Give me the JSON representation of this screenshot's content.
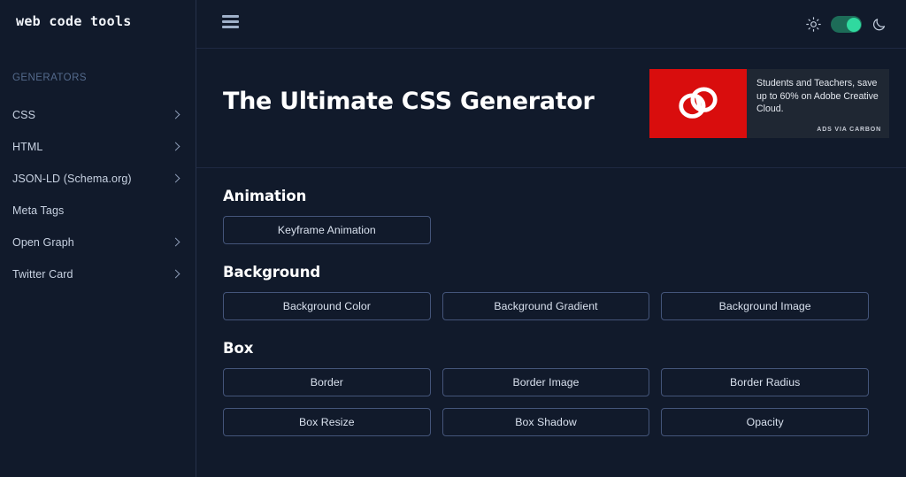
{
  "brand": {
    "name": "web code tools"
  },
  "sidebar": {
    "section_label": "GENERATORS",
    "items": [
      {
        "label": "CSS",
        "has_chevron": true
      },
      {
        "label": "HTML",
        "has_chevron": true
      },
      {
        "label": "JSON-LD (Schema.org)",
        "has_chevron": true
      },
      {
        "label": "Meta Tags",
        "has_chevron": false
      },
      {
        "label": "Open Graph",
        "has_chevron": true
      },
      {
        "label": "Twitter Card",
        "has_chevron": true
      }
    ]
  },
  "topbar": {
    "menu_icon": "hamburger-icon",
    "light_icon": "sun-icon",
    "dark_icon": "moon-icon",
    "theme_toggle_state": "on",
    "toggle_track_color": "#1d6c58",
    "toggle_knob_color": "#30d99f"
  },
  "hero": {
    "title": "The Ultimate CSS Generator"
  },
  "ad": {
    "logo_icon": "adobe-creative-cloud-icon",
    "logo_bg_color": "#d90d0d",
    "text": "Students and Teachers, save up to 60% on Adobe Creative Cloud.",
    "attribution": "ADS VIA CARBON"
  },
  "content": {
    "sections": [
      {
        "title": "Animation",
        "buttons": [
          "Keyframe Animation"
        ]
      },
      {
        "title": "Background",
        "buttons": [
          "Background Color",
          "Background Gradient",
          "Background Image"
        ]
      },
      {
        "title": "Box",
        "buttons": [
          "Border",
          "Border Image",
          "Border Radius",
          "Box Resize",
          "Box Shadow",
          "Opacity"
        ]
      }
    ]
  },
  "colors": {
    "page_bg": "#111a2b",
    "divider": "#1e2942",
    "button_border": "#44557a",
    "muted_label": "#546a8c",
    "text": "#d9e1ee"
  }
}
